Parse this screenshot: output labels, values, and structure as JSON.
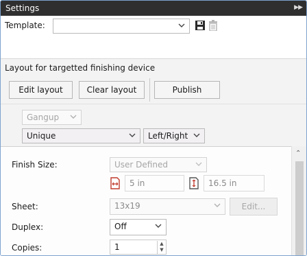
{
  "panel": {
    "title": "Settings"
  },
  "template": {
    "label": "Template:",
    "value": ""
  },
  "layout": {
    "caption": "Layout for targetted finishing device",
    "edit_label": "Edit layout",
    "clear_label": "Clear layout",
    "publish_label": "Publish"
  },
  "gangup": {
    "value": "Gangup"
  },
  "mode": {
    "value": "Unique"
  },
  "side": {
    "value": "Left/Right"
  },
  "finish_size": {
    "label": "Finish Size:",
    "preset": "User Defined",
    "width": "5 in",
    "height": "16.5 in"
  },
  "sheet": {
    "label": "Sheet:",
    "value": "13x19",
    "edit_label": "Edit..."
  },
  "duplex": {
    "label": "Duplex:",
    "value": "Off"
  },
  "copies": {
    "label": "Copies:",
    "value": "1"
  },
  "colors": {
    "titlebar": "#2f2f2f",
    "frame_border": "#7da2ce",
    "section_bg": "#f3f3f3",
    "icon_red": "#c0392b"
  }
}
